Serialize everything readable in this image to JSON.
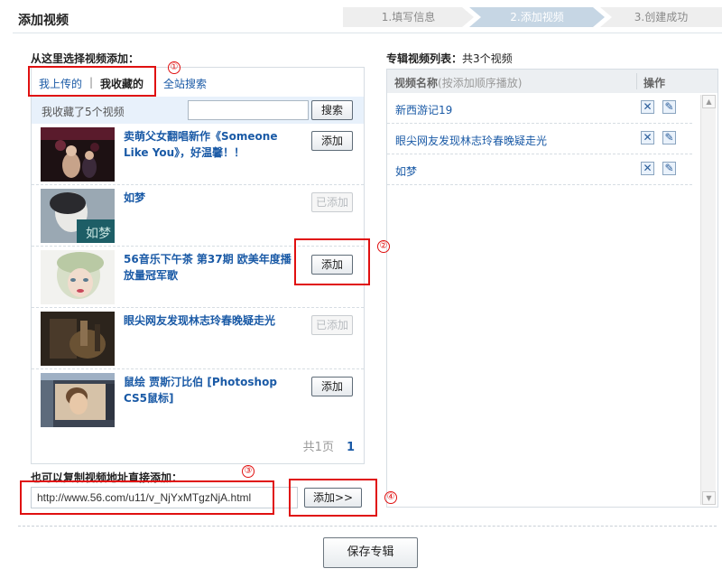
{
  "page": {
    "title": "添加视频"
  },
  "steps": [
    {
      "label": "1.填写信息"
    },
    {
      "label": "2.添加视频"
    },
    {
      "label": "3.创建成功"
    }
  ],
  "left": {
    "label": "从这里选择视频添加：",
    "tabs": [
      {
        "label": "我上传的"
      },
      {
        "label": "我收藏的"
      },
      {
        "label": "全站搜索"
      }
    ],
    "tab_sep": "|",
    "search": {
      "count": "我收藏了5个视频",
      "placeholder": "",
      "button": "搜索"
    },
    "videos": [
      {
        "title": "卖萌父女翻唱新作《Someone Like You》，好温馨！！",
        "button": "添加"
      },
      {
        "title": "如梦",
        "button": "已添加"
      },
      {
        "title": "56音乐下午茶 第37期 欧美年度播放量冠军歌",
        "button": "添加"
      },
      {
        "title": "眼尖网友发现林志玲春晚疑走光",
        "button": "已添加"
      },
      {
        "title": "鼠绘 贾斯汀比伯 [Photoshop CS5鼠标]",
        "button": "添加"
      }
    ],
    "pager": {
      "total": "共1页",
      "current": "1"
    }
  },
  "url_add": {
    "label": "也可以复制视频地址直接添加：",
    "value": "http://www.56.com/u11/v_NjYxMTgzNjA.html",
    "button": "添加>>"
  },
  "right": {
    "label": "专辑视频列表：",
    "count": "共3个视频",
    "col_name": "视频名称",
    "col_name_hint": "(按添加顺序播放)",
    "col_op": "操作",
    "items": [
      {
        "name": "新西游记19"
      },
      {
        "name": "眼尖网友发现林志玲春晚疑走光"
      },
      {
        "name": "如梦"
      }
    ]
  },
  "save_button": "保存专辑",
  "annotations": [
    "①",
    "②",
    "③",
    "④"
  ],
  "colors": {
    "accent": "#1a5aa6",
    "annotation": "#e01010",
    "active_step": "#c6d6e4"
  }
}
